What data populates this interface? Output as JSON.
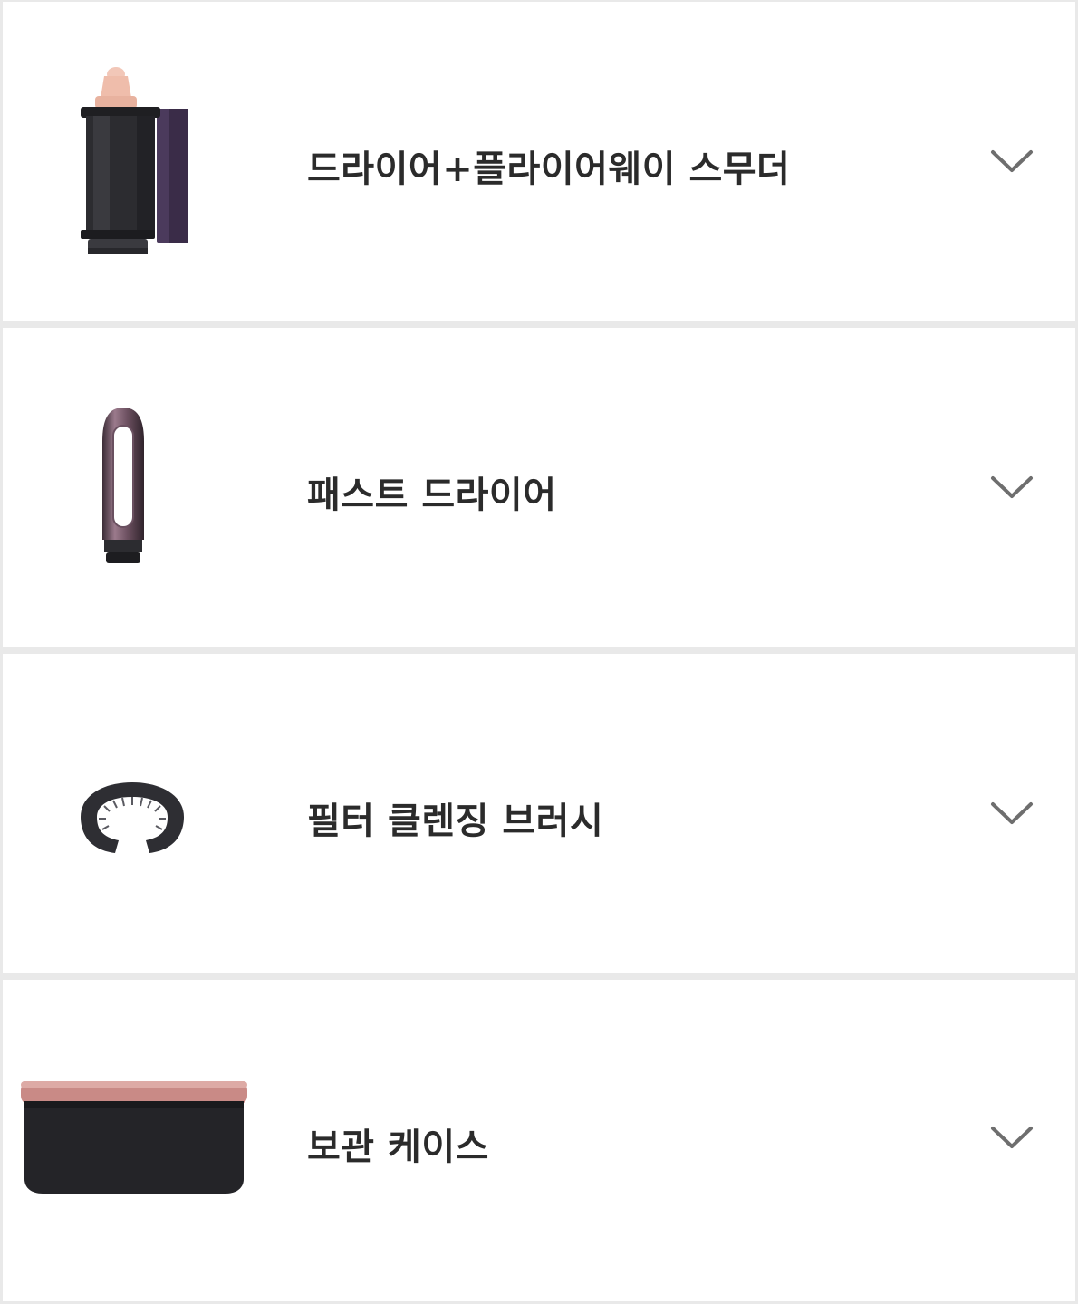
{
  "accessories": [
    {
      "label": "드라이어+플라이어웨이 스무더",
      "icon": "flyaway-smoother-attachment-icon"
    },
    {
      "label": "패스트 드라이어",
      "icon": "fast-dryer-attachment-icon"
    },
    {
      "label": "필터 클렌징 브러시",
      "icon": "filter-cleaning-brush-icon"
    },
    {
      "label": "보관 케이스",
      "icon": "storage-case-icon"
    }
  ],
  "expand_icon": "chevron-down-icon",
  "colors": {
    "background": "#e9e9e9",
    "card": "#ffffff",
    "text": "#2b2b2b",
    "chevron": "#6e6e6e",
    "product_dark": "#2a2a2e",
    "accent_rose": "#c98a86",
    "accent_purple": "#4b3a5c"
  }
}
